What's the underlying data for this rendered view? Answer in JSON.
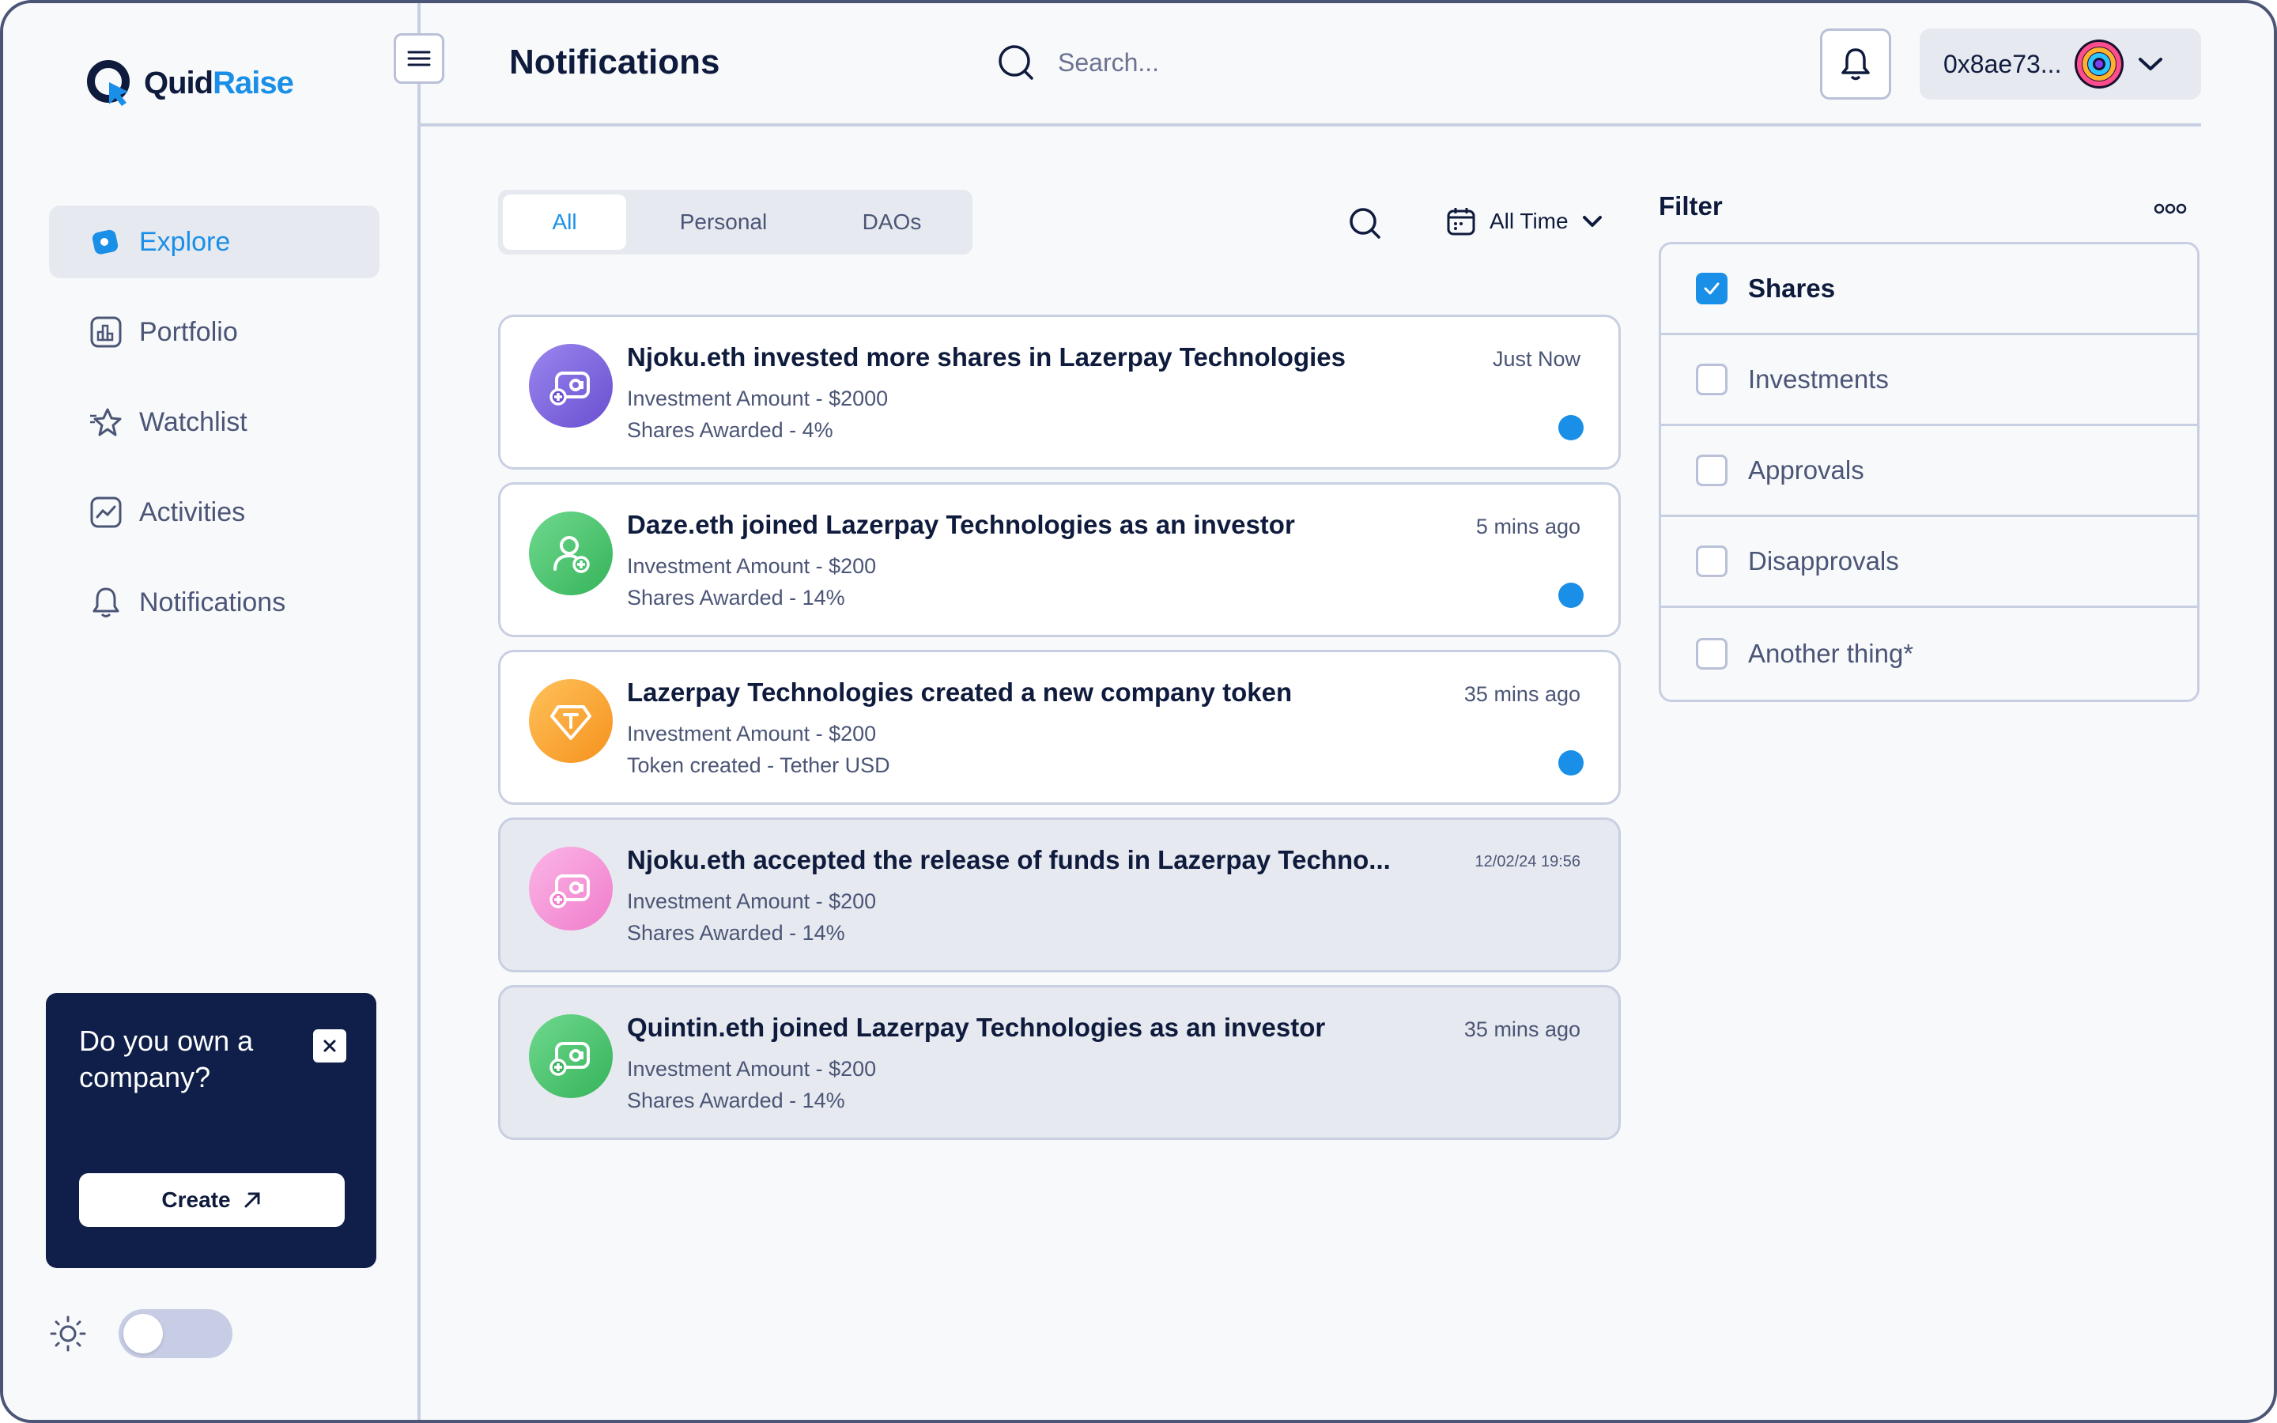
{
  "brand": {
    "name_part1": "Quid",
    "name_part2": "Raise"
  },
  "sidebar": {
    "items": [
      {
        "label": "Explore",
        "icon": "explore-icon",
        "active": true
      },
      {
        "label": "Portfolio",
        "icon": "portfolio-icon",
        "active": false
      },
      {
        "label": "Watchlist",
        "icon": "watchlist-star-icon",
        "active": false
      },
      {
        "label": "Activities",
        "icon": "activities-chart-icon",
        "active": false
      },
      {
        "label": "Notifications",
        "icon": "bell-icon",
        "active": false
      }
    ],
    "promo": {
      "title": "Do you own a company?",
      "button_label": "Create"
    },
    "theme_toggle": {
      "on": false
    }
  },
  "header": {
    "title": "Notifications",
    "search_placeholder": "Search...",
    "wallet_address": "0x8ae73..."
  },
  "tabs": [
    {
      "label": "All",
      "active": true
    },
    {
      "label": "Personal",
      "active": false
    },
    {
      "label": "DAOs",
      "active": false
    }
  ],
  "time_filter": {
    "label": "All Time"
  },
  "notifications": [
    {
      "title": "Njoku.eth invested more shares in Lazerpay Technologies",
      "line1": "Investment Amount - $2000",
      "line2": "Shares Awarded - 4%",
      "time": "Just Now",
      "unread": true,
      "icon": "invest-icon",
      "color": "#7b61d9"
    },
    {
      "title": "Daze.eth joined Lazerpay Technologies as an investor",
      "line1": "Investment Amount - $200",
      "line2": "Shares Awarded - 14%",
      "time": "5 mins ago",
      "unread": true,
      "icon": "add-user-icon",
      "color": "#4cc46e"
    },
    {
      "title": "Lazerpay Technologies created a new company token",
      "line1": "Investment Amount - $200",
      "line2": "Token created - Tether USD",
      "time": "35 mins ago",
      "unread": true,
      "icon": "token-icon",
      "color": "#f7a52d"
    },
    {
      "title": "Njoku.eth accepted the release of funds in Lazerpay Techno...",
      "line1": "Investment Amount - $200",
      "line2": "Shares Awarded - 14%",
      "time": "12/02/24   19:56",
      "unread": false,
      "icon": "invest-icon",
      "color": "#f59ad8"
    },
    {
      "title": "Quintin.eth joined Lazerpay Technologies as an investor",
      "line1": "Investment Amount - $200",
      "line2": "Shares Awarded - 14%",
      "time": "35 mins ago",
      "unread": false,
      "icon": "invest-icon",
      "color": "#4cc46e"
    }
  ],
  "filter": {
    "title": "Filter",
    "options": [
      {
        "label": "Shares",
        "checked": true
      },
      {
        "label": "Investments",
        "checked": false
      },
      {
        "label": "Approvals",
        "checked": false
      },
      {
        "label": "Disapprovals",
        "checked": false
      },
      {
        "label": "Another thing*",
        "checked": false
      }
    ]
  },
  "colors": {
    "accent": "#1a8fe8",
    "navy": "#0f1f4a",
    "border": "#c9cfe3",
    "muted_bg": "#e6e9ef"
  }
}
